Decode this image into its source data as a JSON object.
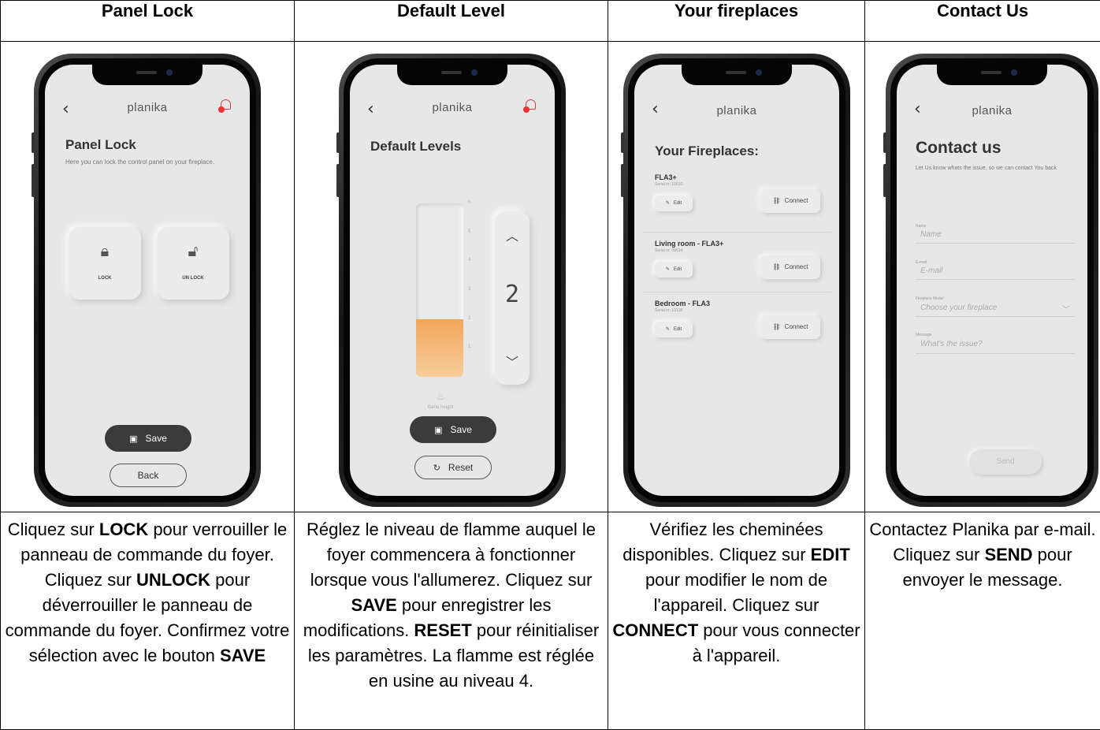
{
  "headers": [
    "Panel Lock",
    "Default Level",
    "Your fireplaces",
    "Contact Us"
  ],
  "phone": {
    "brand": "planika",
    "back_icon": "chevron-left-icon",
    "bell_icon": "bell-icon"
  },
  "panel_lock": {
    "title": "Panel Lock",
    "subtitle": "Here you can lock the control panel on your fireplace.",
    "lock_label": "LOCK",
    "unlock_label": "UN LOCK",
    "save": "Save",
    "back": "Back"
  },
  "default_level": {
    "title": "Default Levels",
    "level": 2,
    "max_level": 6,
    "value_display": "2",
    "ticks": [
      "6",
      "5",
      "4",
      "3",
      "2",
      "1"
    ],
    "caption": "flame height",
    "save": "Save",
    "reset": "Reset",
    "fill_color": "#f2a65a"
  },
  "fireplaces": {
    "title": "Your Fireplaces:",
    "edit_label": "Edit",
    "connect_label": "Connect",
    "items": [
      {
        "name": "FLA3+",
        "serial": "Serial nr: 10010"
      },
      {
        "name": "Living room - FLA3+",
        "serial": "Serial nr: 09614"
      },
      {
        "name": "Bedroom - FLA3",
        "serial": "Serial nr: 10138"
      }
    ]
  },
  "contact": {
    "title": "Contact us",
    "subtitle": "Let Us know whats the issue, so we can contact You back",
    "fields": [
      {
        "label": "Name",
        "placeholder": "Name"
      },
      {
        "label": "E-mail",
        "placeholder": "E-mail"
      },
      {
        "label": "Fireplace Model",
        "placeholder": "Choose your fireplace"
      },
      {
        "label": "Message",
        "placeholder": "What's the issue?"
      }
    ],
    "send": "Send"
  },
  "captions": {
    "c1": [
      "Cliquez sur ",
      "LOCK",
      " pour verrouiller le panneau de commande du foyer. Cliquez sur ",
      "UNLOCK",
      " pour déverrouiller le panneau de commande du foyer. Confirmez votre sélection avec le bouton ",
      "SAVE"
    ],
    "c2": [
      "Réglez le niveau de flamme auquel le foyer commencera à fonctionner lorsque vous l'allumerez. Cliquez sur ",
      "SAVE",
      " pour enregistrer les modifications. ",
      "RESET",
      " pour réinitialiser les paramètres. La flamme est réglée en usine au niveau 4."
    ],
    "c3": [
      "Vérifiez les cheminées disponibles. Cliquez sur ",
      "EDIT",
      " pour modifier le nom de l'appareil. Cliquez sur ",
      "CONNECT",
      " pour vous connecter à l'appareil."
    ],
    "c4": [
      "Contactez Planika par e-mail. Cliquez sur ",
      "SEND",
      " pour envoyer le message."
    ]
  }
}
